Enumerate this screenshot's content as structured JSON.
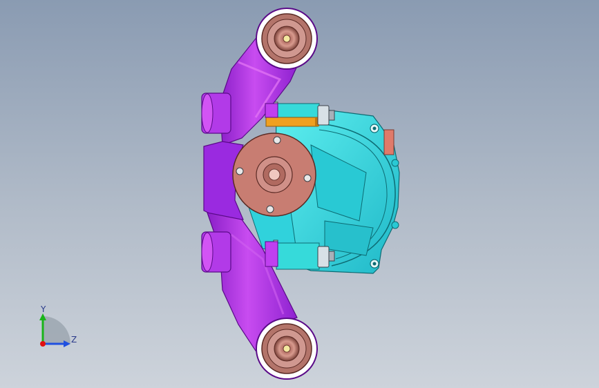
{
  "viewport": {
    "background_top": "#8a9bb2",
    "background_bottom": "#cdd3db"
  },
  "model": {
    "bracket_color": "#a22ce6",
    "bracket_highlight": "#e678f5",
    "housing_color": "#37e1e1",
    "flange_color": "#c87d72",
    "bushing_color": "#b4736a",
    "rod_color": "#f0a020"
  },
  "triad": {
    "y_label": "Y",
    "z_label": "Z",
    "y_color": "#19b419",
    "z_color": "#2050e0",
    "x_color": "#e01010"
  }
}
